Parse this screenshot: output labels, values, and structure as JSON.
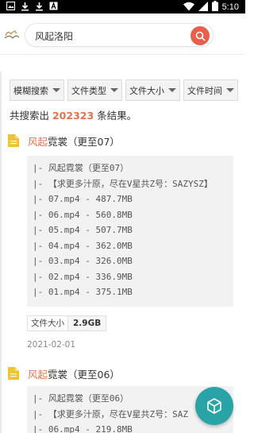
{
  "status_bar": {
    "time": "5:10",
    "left_icons": [
      "image-icon",
      "download-icon",
      "download-icon",
      "a-box-icon"
    ],
    "right_icons": [
      "wifi-icon",
      "signal-icon",
      "battery-icon"
    ]
  },
  "search": {
    "value": "风起洛阳"
  },
  "filters": [
    {
      "label": "模糊搜索"
    },
    {
      "label": "文件类型"
    },
    {
      "label": "文件大小"
    },
    {
      "label": "文件时间"
    }
  ],
  "summary": {
    "prefix": "共搜索出 ",
    "count": "202323",
    "suffix": " 条结果。"
  },
  "results": [
    {
      "title_highlight": "风起",
      "title_rest": "霓裳（更至07）",
      "lines": [
        "|- 风起霓裳（更至07）",
        "|- 【求更多汁原，尽在V星共Z号：SAZYSZ】",
        "|- 07.mp4 - 487.7MB",
        "|- 06.mp4 - 560.8MB",
        "|- 05.mp4 - 507.7MB",
        "|- 04.mp4 - 362.0MB",
        "|- 03.mp4 - 326.0MB",
        "|- 02.mp4 - 336.9MB",
        "|- 01.mp4 - 375.1MB"
      ],
      "size_label": "文件大小",
      "size_value": "2.9GB",
      "date": "2021-02-01"
    },
    {
      "title_highlight": "风起",
      "title_rest": "霓裳（更至06）",
      "lines": [
        "|- 风起霓裳（更至06）",
        "|- 【求更多汁原，尽在V星共Z号：SAZ",
        "|- 06.mp4 - 219.8MB"
      ]
    }
  ],
  "colors": {
    "accent": "#e0734e",
    "search_button": "#e8604c",
    "fab": "#2aa3a6",
    "file_icon": "#f1c232"
  },
  "fab": {
    "icon": "cube-icon"
  }
}
